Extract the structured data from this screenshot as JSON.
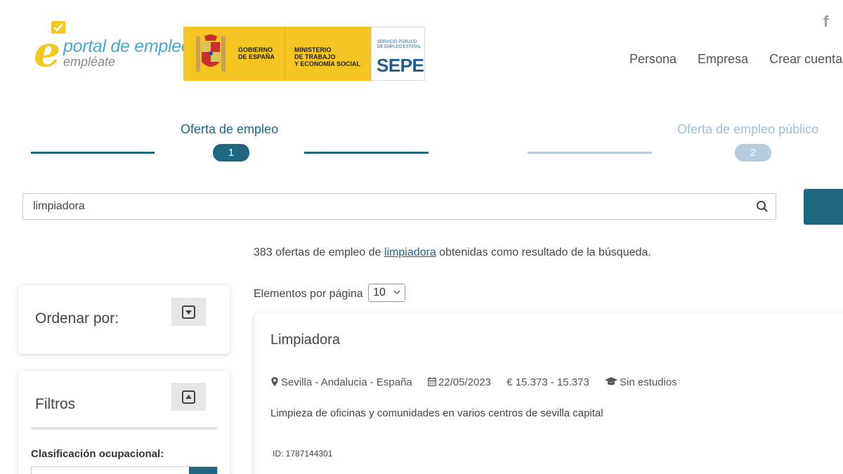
{
  "header": {
    "logo": {
      "line1": "portal de empleo",
      "line2": "empléate"
    },
    "gov": {
      "gobierno": [
        "GOBIERNO",
        "DE ESPAÑA"
      ],
      "ministerio": [
        "MINISTERIO",
        "DE TRABAJO",
        "Y ECONOMÍA SOCIAL"
      ],
      "sepe_small": [
        "SERVICIO PÚBLICO",
        "DE EMPLEO ESTATAL"
      ],
      "sepe_big": "SEPE"
    },
    "facebook_label": "f",
    "nav": [
      "Persona",
      "Empresa",
      "Crear cuenta"
    ]
  },
  "stepper": {
    "step1_label": "Oferta de empleo",
    "step1_number": "1",
    "step2_label": "Oferta de empleo público",
    "step2_number": "2"
  },
  "search": {
    "query": "limpiadora",
    "icon": "search-icon"
  },
  "results": {
    "count": "383",
    "text_before": " ofertas de empleo de ",
    "term": "limpiadora",
    "text_after": " obtenidas como resultado de la búsqueda.",
    "per_page_label": "Elementos por página",
    "per_page_value": "10"
  },
  "sidebar": {
    "sort_title": "Ordenar por:",
    "filter_title": "Filtros",
    "filter_subtitle": "Clasificación ocupacional:"
  },
  "job": {
    "title": "Limpiadora",
    "location": "Sevilla - Andalucia - España",
    "date": "22/05/2023",
    "salary": "€ 15.373 - 15.373",
    "education": "Sin estudios",
    "description": "Limpieza de oficinas y comunidades en varios centros de sevilla capital",
    "id": "ID: 1787144301"
  },
  "colors": {
    "primary": "#1f6781",
    "inactive": "#b7cddd",
    "logo_yellow": "#f4c81f",
    "logo_blue": "#4aa8d2"
  }
}
